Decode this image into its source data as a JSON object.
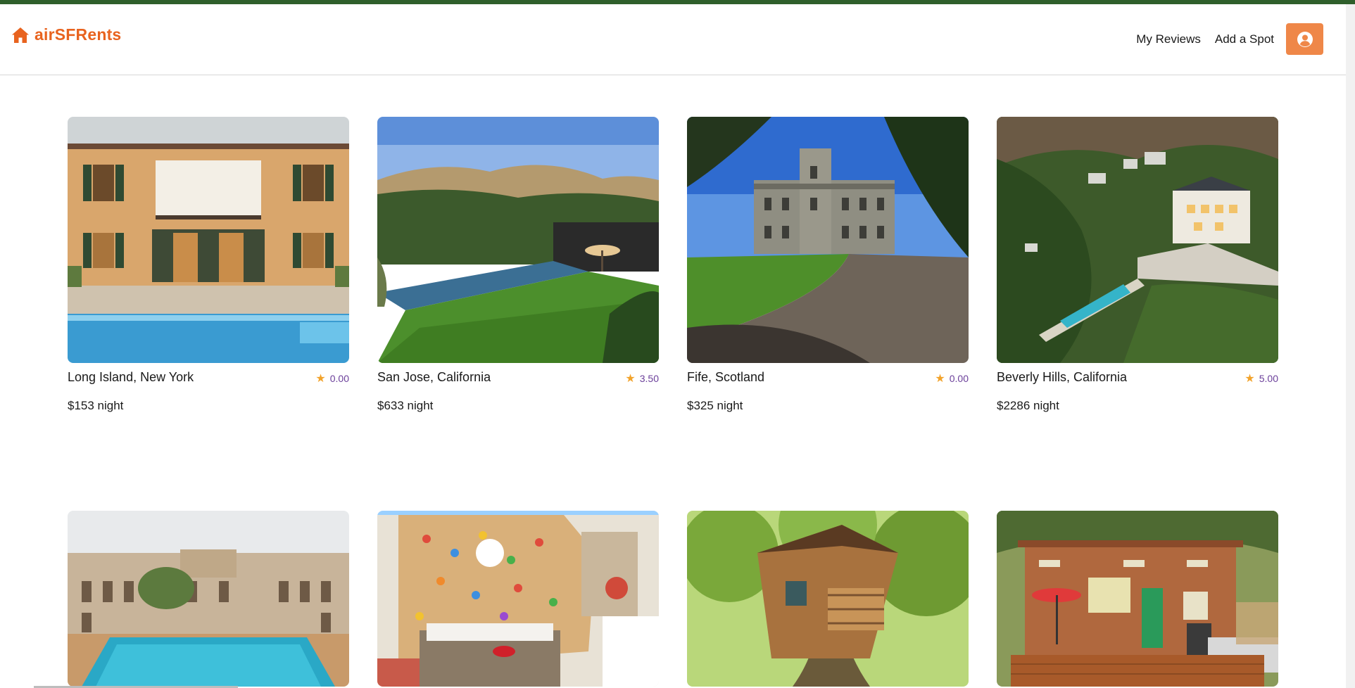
{
  "app": {
    "logo_text": "airSFRents",
    "logo_icon": "home-icon",
    "brand_color": "#e8631f"
  },
  "nav": {
    "my_reviews": "My Reviews",
    "add_spot": "Add a Spot",
    "profile_icon": "user-circle-icon"
  },
  "listings": [
    {
      "city": "Long Island, New York",
      "rating": "0.00",
      "price": "$153 night"
    },
    {
      "city": "San Jose, California",
      "rating": "3.50",
      "price": "$633 night"
    },
    {
      "city": "Fife, Scotland",
      "rating": "0.00",
      "price": "$325 night"
    },
    {
      "city": "Beverly Hills, California",
      "rating": "5.00",
      "price": "$2286 night"
    }
  ],
  "colors": {
    "top_bar": "#2f5f2b",
    "profile_button": "#ef8748",
    "rating_text": "#6b3f9a",
    "star": "#f2a32b"
  }
}
